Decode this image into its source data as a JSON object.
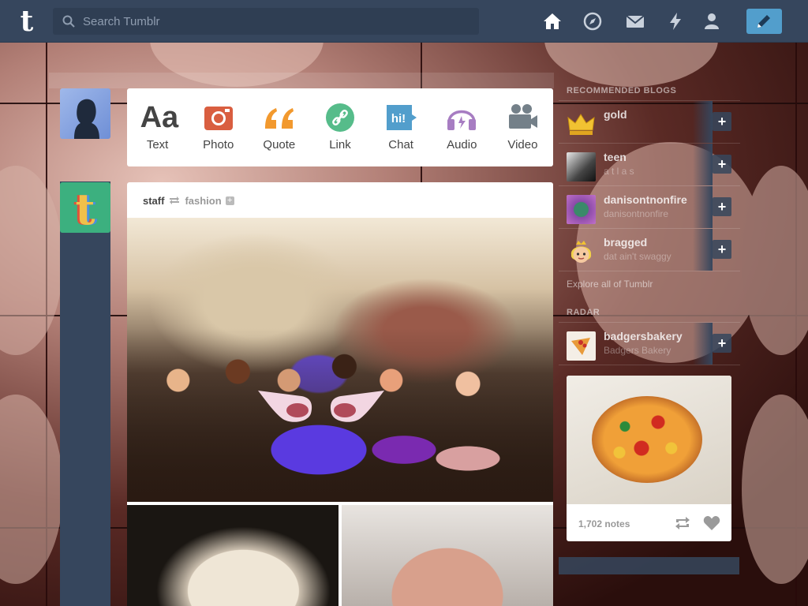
{
  "header": {
    "logo": "t",
    "search_placeholder": "Search Tumblr",
    "nav": [
      "home-icon",
      "explore-icon",
      "inbox-icon",
      "activity-icon",
      "account-icon"
    ],
    "compose_icon": "pencil-icon"
  },
  "post_bar": {
    "types": [
      {
        "label": "Text",
        "icon": "Aa",
        "color": "#444444"
      },
      {
        "label": "Photo",
        "icon": "camera-icon",
        "color": "#d95e40"
      },
      {
        "label": "Quote",
        "icon": "quote-icon",
        "color": "#f2992e"
      },
      {
        "label": "Link",
        "icon": "link-icon",
        "color": "#56bc8a"
      },
      {
        "label": "Chat",
        "icon": "hi!",
        "color": "#529ecc"
      },
      {
        "label": "Audio",
        "icon": "headphones-icon",
        "color": "#a77dc2"
      },
      {
        "label": "Video",
        "icon": "video-camera-icon",
        "color": "#748089"
      }
    ]
  },
  "post": {
    "author": "staff",
    "reblogged_from": "fashion"
  },
  "sidebar": {
    "recommended_heading": "RECOMMENDED BLOGS",
    "blogs": [
      {
        "name": "gold",
        "sub": ""
      },
      {
        "name": "teen",
        "sub": "a t l a s"
      },
      {
        "name": "danisontnonfire",
        "sub": "danisontnonfire"
      },
      {
        "name": "bragged",
        "sub": "dat ain't swaggy"
      }
    ],
    "explore": "Explore all of Tumblr",
    "radar_heading": "RADAR",
    "radar_blog": {
      "name": "badgersbakery",
      "sub": "Badgers Bakery"
    },
    "radar_notes": "1,702 notes"
  }
}
